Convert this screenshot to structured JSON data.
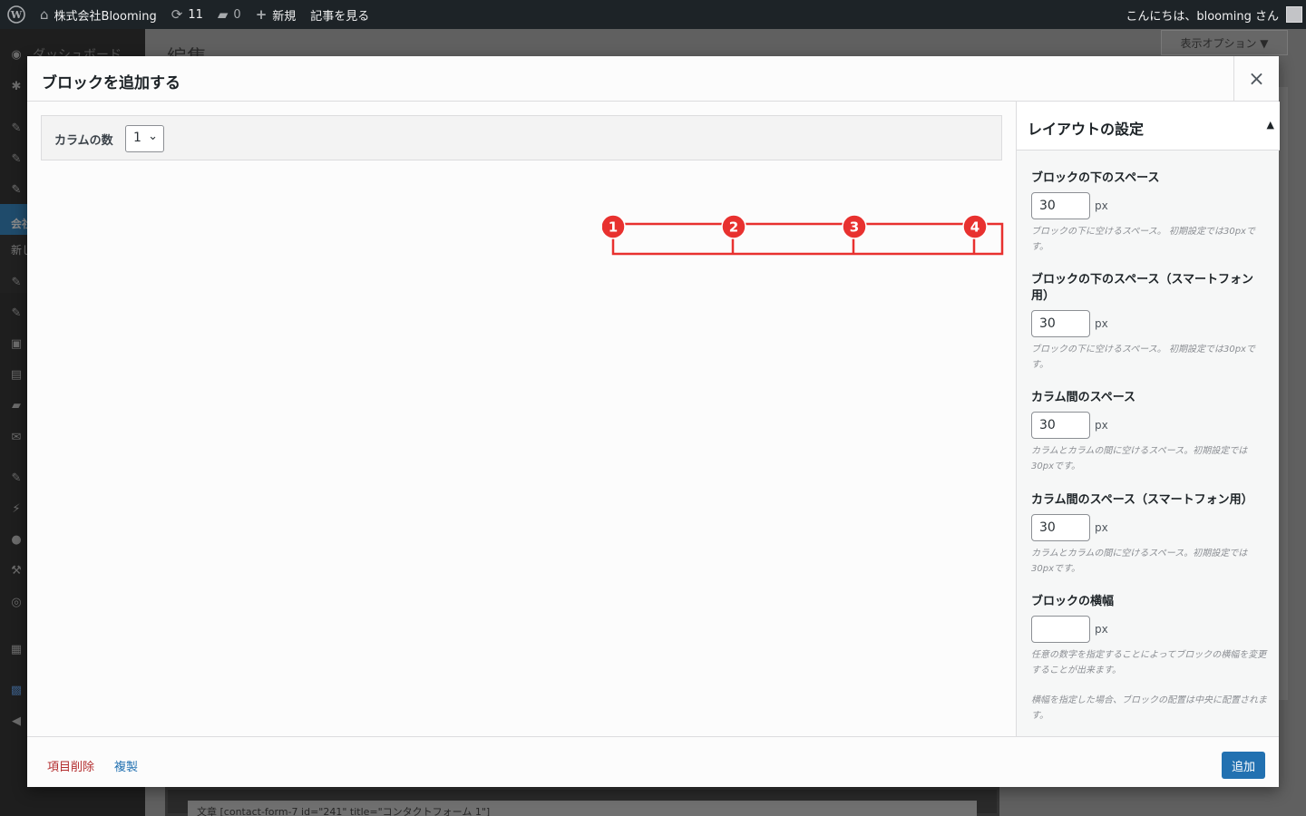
{
  "adminbar": {
    "site_name": "株式会社Blooming",
    "updates_count": "11",
    "comments_count": "0",
    "new_label": "新規",
    "view_post_label": "記事を見る",
    "greeting": "こんにちは、blooming さん"
  },
  "background": {
    "page_title": "編集",
    "screen_options": "表示オプション ▼",
    "sidebar_dashboard": "ダッシュボード",
    "sidebar_active_label": "会社",
    "sidebar_sub_label": "新し",
    "bottom_block_text": "文章 [contact-form-7 id=\"241\" title=\"コンタクトフォーム 1\"]"
  },
  "modal": {
    "title": "ブロックを追加する",
    "close_label": "×",
    "columns_label": "カラムの数",
    "columns_value": "1",
    "diagram_markers": [
      "1",
      "2",
      "3",
      "4"
    ],
    "panel": {
      "title": "レイアウトの設定",
      "toggle": "▲",
      "fields": [
        {
          "label": "ブロックの下のスペース",
          "value": "30",
          "unit": "px",
          "desc": "ブロックの下に空けるスペース。 初期設定では30pxです。"
        },
        {
          "label": "ブロックの下のスペース（スマートフォン用）",
          "value": "30",
          "unit": "px",
          "desc": "ブロックの下に空けるスペース。 初期設定では30pxです。"
        },
        {
          "label": "カラム間のスペース",
          "value": "30",
          "unit": "px",
          "desc": "カラムとカラムの間に空けるスペース。初期設定では30pxです。"
        },
        {
          "label": "カラム間のスペース（スマートフォン用）",
          "value": "30",
          "unit": "px",
          "desc": "カラムとカラムの間に空けるスペース。初期設定では30pxです。"
        },
        {
          "label": "ブロックの横幅",
          "value": "",
          "unit": "px",
          "desc": "任意の数字を指定することによってブロックの横幅を変更することが出来ます。",
          "desc2": "横幅を指定した場合、ブロックの配置は中央に配置されます。"
        }
      ]
    },
    "footer": {
      "delete_label": "項目削除",
      "duplicate_label": "複製",
      "add_label": "追加"
    }
  },
  "colors": {
    "accent": "#2271b1",
    "danger": "#b32d2e",
    "marker": "#e8312f"
  }
}
